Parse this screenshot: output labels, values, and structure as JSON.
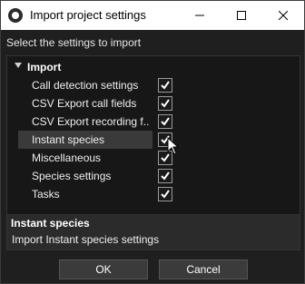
{
  "window": {
    "title": "Import project settings",
    "app_icon": "app-logo-icon"
  },
  "instruction": "Select the settings to import",
  "tree": {
    "group_label": "Import",
    "items": [
      {
        "label": "Call detection settings",
        "checked": true
      },
      {
        "label": "CSV Export call fields",
        "checked": true
      },
      {
        "label": "CSV Export recording f...",
        "checked": true
      },
      {
        "label": "Instant species",
        "checked": true,
        "selected": true
      },
      {
        "label": "Miscellaneous",
        "checked": true
      },
      {
        "label": "Species settings",
        "checked": true
      },
      {
        "label": "Tasks",
        "checked": true
      }
    ]
  },
  "description": {
    "title": "Instant species",
    "body": "Import Instant species settings"
  },
  "buttons": {
    "ok": "OK",
    "cancel": "Cancel"
  },
  "colors": {
    "background": "#1f1f1f",
    "titlebar": "#ffffff",
    "selection": "#3a3a3a"
  }
}
